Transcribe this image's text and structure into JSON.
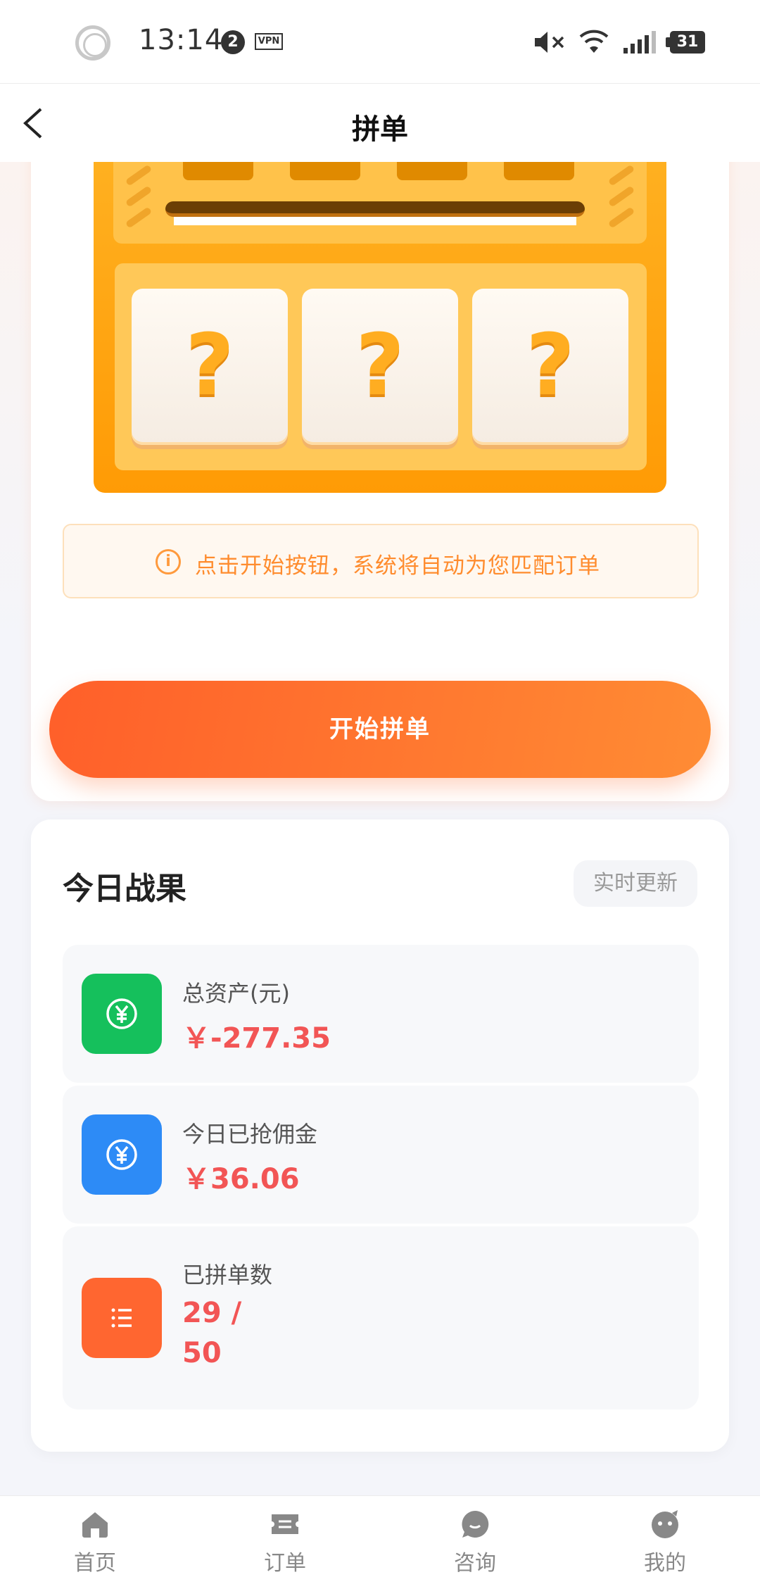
{
  "status_bar": {
    "time": "13:14",
    "notification_count": "2",
    "vpn": "VPN",
    "battery": "31"
  },
  "header": {
    "title": "拼单"
  },
  "machine": {
    "tiles": [
      "?",
      "?",
      "?"
    ]
  },
  "tip": {
    "icon": "i",
    "text": "点击开始按钮，系统将自动为您匹配订单"
  },
  "start_button": {
    "label": "开始拼单"
  },
  "results": {
    "title": "今日战果",
    "badge": "实时更新",
    "rows": [
      {
        "icon": "yuan-icon",
        "color": "#15c05c",
        "label": "总资产(元)",
        "value": "￥-277.35"
      },
      {
        "icon": "yuan-icon",
        "color": "#2d8bf6",
        "label": "今日已抢佣金",
        "value": "￥36.06"
      },
      {
        "icon": "list-icon",
        "color": "#ff6630",
        "label": "已拼单数",
        "value_line1": "29 /",
        "value_line2": "50"
      }
    ]
  },
  "nav": {
    "items": [
      {
        "label": "首页",
        "icon": "home-icon"
      },
      {
        "label": "订单",
        "icon": "ticket-icon"
      },
      {
        "label": "咨询",
        "icon": "chat-icon"
      },
      {
        "label": "我的",
        "icon": "profile-icon"
      }
    ]
  }
}
